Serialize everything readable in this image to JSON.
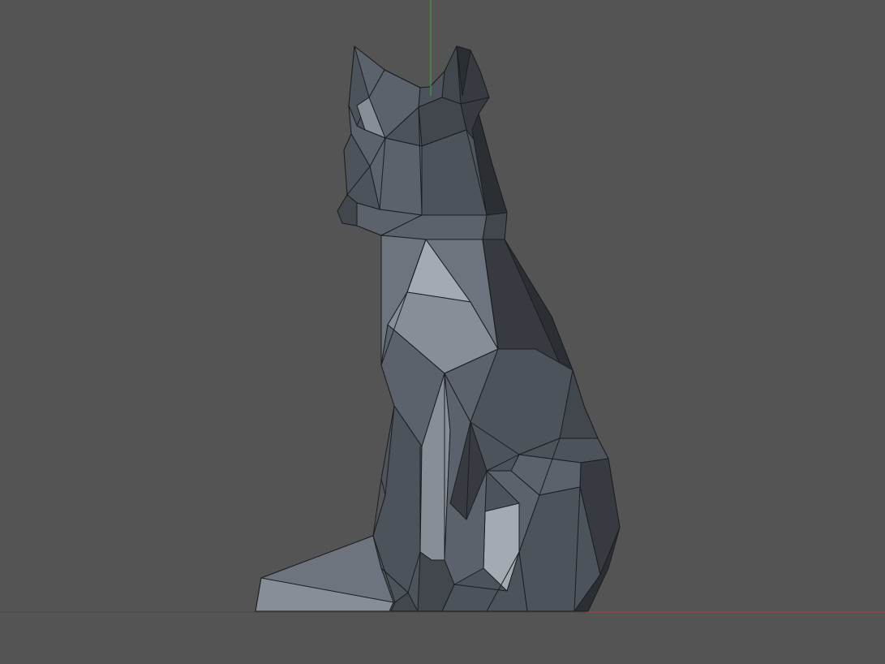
{
  "viewport": {
    "background_color": "#545454",
    "model_name": "low-poly-fox",
    "shading": "solid-flat",
    "wireframe_edges": true
  },
  "axes": {
    "x_axis_color": "#b03a3a",
    "y_axis_color": "#3cae3c",
    "ground_line_color": "#484848"
  },
  "model_colors": {
    "edge": "#1b1d21",
    "darkest": "#2b2e33",
    "dark": "#373b41",
    "mid_dark": "#42474e",
    "mid": "#4d535b",
    "mid_light": "#5c626b",
    "light": "#6d747d",
    "lighter": "#878e96",
    "lightest": "#a3aab2"
  }
}
